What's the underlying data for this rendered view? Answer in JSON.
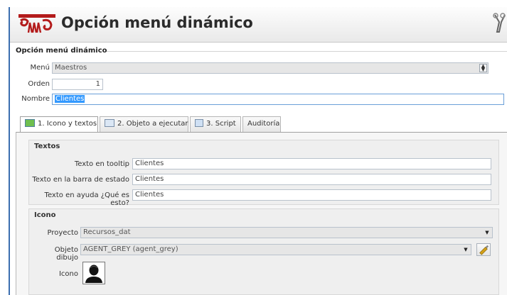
{
  "header": {
    "title": "Opción menú dinámico"
  },
  "form": {
    "legend": "Opción menú dinámico",
    "menu": {
      "label": "Menú",
      "value": "Maestros"
    },
    "orden": {
      "label": "Orden",
      "value": "1"
    },
    "nombre": {
      "label": "Nombre",
      "value": "Clientes"
    }
  },
  "tabs": [
    {
      "label": "1. Icono y textos",
      "active": true
    },
    {
      "label": "2. Objeto a ejecutar",
      "active": false
    },
    {
      "label": "3. Script",
      "active": false
    },
    {
      "label": "Auditoría",
      "active": false
    }
  ],
  "textos": {
    "title": "Textos",
    "tooltip": {
      "label": "Texto en tooltip",
      "value": "Clientes"
    },
    "barra": {
      "label": "Texto en la barra de estado",
      "value": "Clientes"
    },
    "ayuda": {
      "label": "Texto en ayuda ¿Qué es esto?",
      "value": "Clientes"
    }
  },
  "icono": {
    "title": "Icono",
    "proyecto": {
      "label": "Proyecto",
      "value": "Recursos_dat"
    },
    "objeto": {
      "label": "Objeto dibujo",
      "value": "AGENT_GREY  (agent_grey)"
    },
    "icono_label": "Icono"
  },
  "icons": {
    "logo": "temple-frieze-logo",
    "tools": "tools-icon",
    "tab1": "image-icon",
    "tab2": "window-icon",
    "tab3": "script-icon",
    "brush": "paint-brush-icon",
    "preview": "person-icon"
  }
}
